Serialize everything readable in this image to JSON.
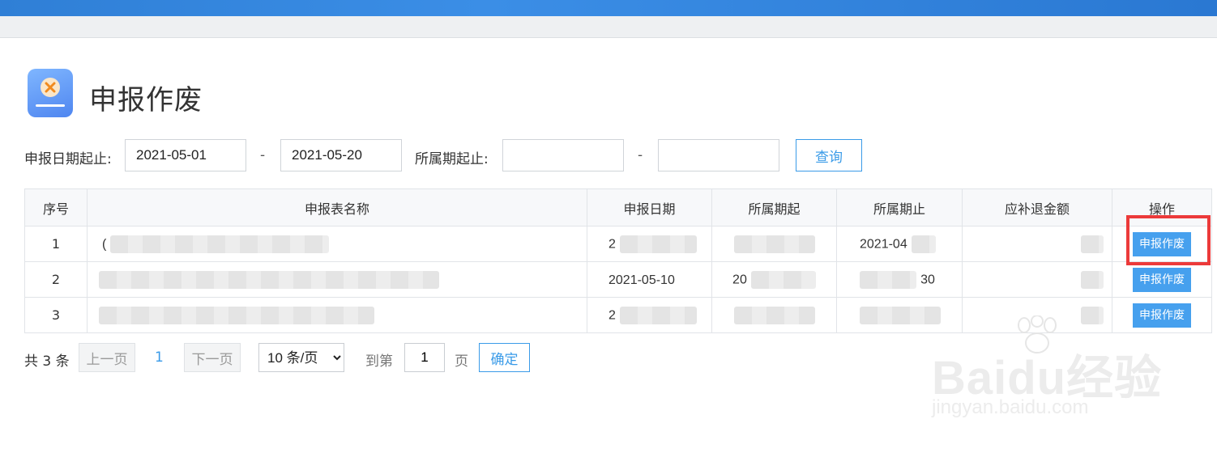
{
  "colors": {
    "accent": "#3a9be8",
    "button_bg": "#46a0ee",
    "highlight": "#ec3a3a",
    "topbar": "#2f7fd6"
  },
  "page": {
    "title": "申报作废",
    "icon": "void-declaration-icon"
  },
  "filters": {
    "date_range_label": "申报日期起止:",
    "date_from": "2021-05-01",
    "date_to": "2021-05-20",
    "dash": "-",
    "period_range_label": "所属期起止:",
    "period_from": "",
    "period_to": "",
    "query_label": "查询"
  },
  "table": {
    "headers": [
      "序号",
      "申报表名称",
      "申报日期",
      "所属期起",
      "所属期止",
      "应补退金额",
      "操作"
    ],
    "rows": [
      {
        "index": "1",
        "name_partial": "(",
        "date_partial": "2",
        "period_from_partial": "",
        "period_to_partial": "2021-04",
        "action": "申报作废"
      },
      {
        "index": "2",
        "name_partial": "",
        "date_partial": "2021-05-10",
        "period_from_partial": "20",
        "period_to_partial": "30",
        "action": "申报作废"
      },
      {
        "index": "3",
        "name_partial": "",
        "date_partial": "2",
        "period_from_partial": "",
        "period_to_partial": "",
        "action": "申报作废"
      }
    ]
  },
  "pagination": {
    "total": "共 3 条",
    "prev": "上一页",
    "current_page": "1",
    "next": "下一页",
    "page_size": "10 条/页",
    "goto_label": "到第",
    "goto_value": "1",
    "page_suffix": "页",
    "confirm": "确定"
  },
  "watermark": {
    "logo": "Baidu经验",
    "url": "jingyan.baidu.com"
  }
}
